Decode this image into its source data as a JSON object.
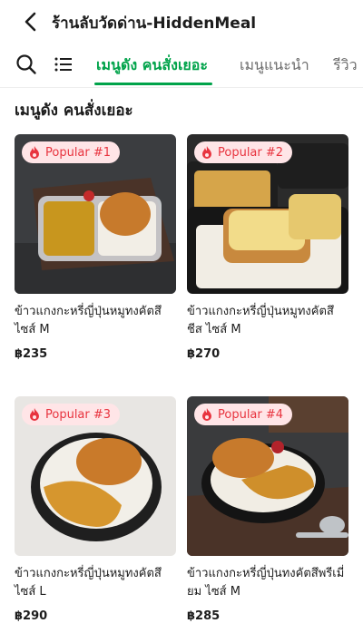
{
  "header": {
    "title": "ร้านลับวัดด่าน-HiddenMeal",
    "back_icon": "chevron-left-icon"
  },
  "toolbar": {
    "search_icon": "search-icon",
    "menu_icon": "menu-list-icon"
  },
  "tabs": [
    {
      "label": "เมนูดัง คนสั่งเยอะ",
      "active": true
    },
    {
      "label": "เมนูแนะนำ",
      "active": false
    },
    {
      "label": "รีวิว",
      "active": false
    }
  ],
  "section": {
    "title": "เมนูดัง คนสั่งเยอะ"
  },
  "colors": {
    "accent": "#00a34a",
    "badge_bg": "#ffe5e7",
    "badge_text": "#e8343f"
  },
  "items": [
    {
      "badge": "Popular #1",
      "name": "ข้าวแกงกะหรี่ญี่ปุ่นหมูทงคัตสึ ไซส์ M",
      "price": "฿235"
    },
    {
      "badge": "Popular #2",
      "name": "ข้าวแกงกะหรี่ญี่ปุ่นหมูทงคัตสึ ชีส ไซส์ M",
      "price": "฿270"
    },
    {
      "badge": "Popular #3",
      "name": "ข้าวแกงกะหรี่ญี่ปุ่นหมูทงคัตสึ ไซส์ L",
      "price": "฿290"
    },
    {
      "badge": "Popular #4",
      "name": "ข้าวแกงกะหรี่ญี่ปุ่นทงคัตสึพรีเมี่ยม ไซส์ M",
      "price": "฿285"
    }
  ]
}
